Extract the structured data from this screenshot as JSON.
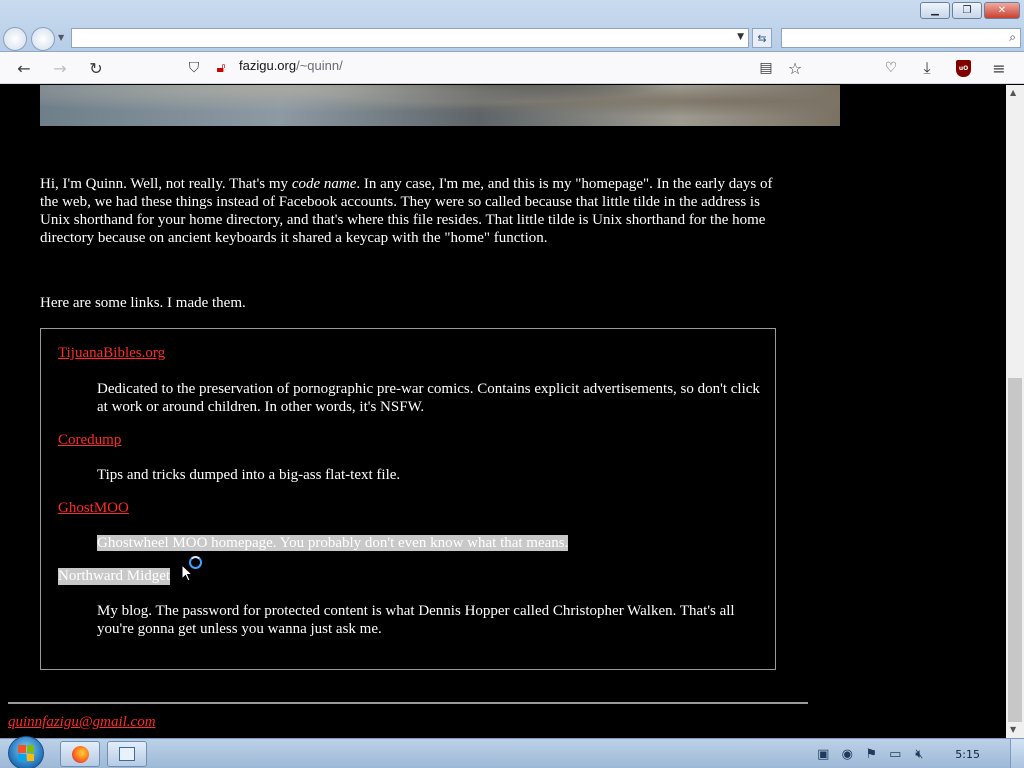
{
  "browser": {
    "url_host": "fazigu.org",
    "url_path": "/~quinn/",
    "window_buttons": {
      "minimize": "▁",
      "restore": "❐",
      "close": "✕"
    }
  },
  "page": {
    "intro_before_em": "Hi, I'm Quinn. Well, not really. That's my ",
    "intro_em": "code name",
    "intro_after_em": ". In any case, I'm me, and this is my \"homepage\". In the early days of the web, we had these things instead of Facebook accounts. They were so called because that little tilde in the address is Unix shorthand for your home directory, and that's where this file resides. That little tilde is Unix shorthand for the home directory because on ancient keyboards it shared a keycap with the \"home\" function.",
    "links_intro": "Here are some links. I made them.",
    "links": [
      {
        "title": "TijuanaBibles.org",
        "desc": "Dedicated to the preservation of pornographic pre-war comics. Contains explicit advertisements, so don't click at work or around children. In other words, it's NSFW."
      },
      {
        "title": "Coredump",
        "desc": "Tips and tricks dumped into a big-ass flat-text file."
      },
      {
        "title": "GhostMOO",
        "desc": "Ghostwheel MOO homepage. You probably don't even know what that means."
      },
      {
        "title": "Northward Midget",
        "desc": "My blog. The password for protected content is what Dennis Hopper called Christopher Walken. That's all you're gonna get unless you wanna just ask me."
      }
    ],
    "footer_email": "quinnfazigu@gmail.com"
  },
  "taskbar": {
    "clock": "5:15"
  },
  "colors": {
    "page_background": "#000000",
    "link": "#ff2a2a",
    "selection": "#c8c8c8",
    "text": "#ffffff"
  }
}
